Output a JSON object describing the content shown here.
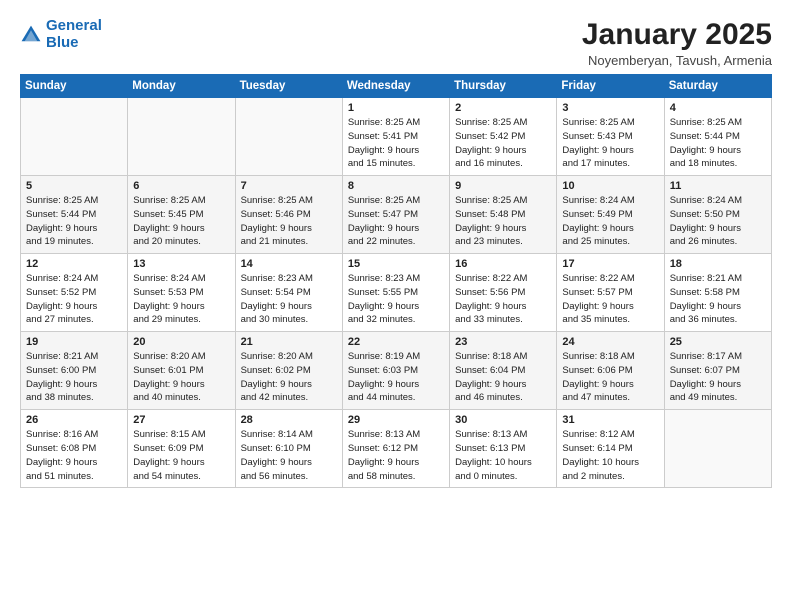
{
  "logo": {
    "line1": "General",
    "line2": "Blue"
  },
  "title": "January 2025",
  "location": "Noyemberyan, Tavush, Armenia",
  "weekdays": [
    "Sunday",
    "Monday",
    "Tuesday",
    "Wednesday",
    "Thursday",
    "Friday",
    "Saturday"
  ],
  "weeks": [
    [
      {
        "day": "",
        "text": ""
      },
      {
        "day": "",
        "text": ""
      },
      {
        "day": "",
        "text": ""
      },
      {
        "day": "1",
        "text": "Sunrise: 8:25 AM\nSunset: 5:41 PM\nDaylight: 9 hours\nand 15 minutes."
      },
      {
        "day": "2",
        "text": "Sunrise: 8:25 AM\nSunset: 5:42 PM\nDaylight: 9 hours\nand 16 minutes."
      },
      {
        "day": "3",
        "text": "Sunrise: 8:25 AM\nSunset: 5:43 PM\nDaylight: 9 hours\nand 17 minutes."
      },
      {
        "day": "4",
        "text": "Sunrise: 8:25 AM\nSunset: 5:44 PM\nDaylight: 9 hours\nand 18 minutes."
      }
    ],
    [
      {
        "day": "5",
        "text": "Sunrise: 8:25 AM\nSunset: 5:44 PM\nDaylight: 9 hours\nand 19 minutes."
      },
      {
        "day": "6",
        "text": "Sunrise: 8:25 AM\nSunset: 5:45 PM\nDaylight: 9 hours\nand 20 minutes."
      },
      {
        "day": "7",
        "text": "Sunrise: 8:25 AM\nSunset: 5:46 PM\nDaylight: 9 hours\nand 21 minutes."
      },
      {
        "day": "8",
        "text": "Sunrise: 8:25 AM\nSunset: 5:47 PM\nDaylight: 9 hours\nand 22 minutes."
      },
      {
        "day": "9",
        "text": "Sunrise: 8:25 AM\nSunset: 5:48 PM\nDaylight: 9 hours\nand 23 minutes."
      },
      {
        "day": "10",
        "text": "Sunrise: 8:24 AM\nSunset: 5:49 PM\nDaylight: 9 hours\nand 25 minutes."
      },
      {
        "day": "11",
        "text": "Sunrise: 8:24 AM\nSunset: 5:50 PM\nDaylight: 9 hours\nand 26 minutes."
      }
    ],
    [
      {
        "day": "12",
        "text": "Sunrise: 8:24 AM\nSunset: 5:52 PM\nDaylight: 9 hours\nand 27 minutes."
      },
      {
        "day": "13",
        "text": "Sunrise: 8:24 AM\nSunset: 5:53 PM\nDaylight: 9 hours\nand 29 minutes."
      },
      {
        "day": "14",
        "text": "Sunrise: 8:23 AM\nSunset: 5:54 PM\nDaylight: 9 hours\nand 30 minutes."
      },
      {
        "day": "15",
        "text": "Sunrise: 8:23 AM\nSunset: 5:55 PM\nDaylight: 9 hours\nand 32 minutes."
      },
      {
        "day": "16",
        "text": "Sunrise: 8:22 AM\nSunset: 5:56 PM\nDaylight: 9 hours\nand 33 minutes."
      },
      {
        "day": "17",
        "text": "Sunrise: 8:22 AM\nSunset: 5:57 PM\nDaylight: 9 hours\nand 35 minutes."
      },
      {
        "day": "18",
        "text": "Sunrise: 8:21 AM\nSunset: 5:58 PM\nDaylight: 9 hours\nand 36 minutes."
      }
    ],
    [
      {
        "day": "19",
        "text": "Sunrise: 8:21 AM\nSunset: 6:00 PM\nDaylight: 9 hours\nand 38 minutes."
      },
      {
        "day": "20",
        "text": "Sunrise: 8:20 AM\nSunset: 6:01 PM\nDaylight: 9 hours\nand 40 minutes."
      },
      {
        "day": "21",
        "text": "Sunrise: 8:20 AM\nSunset: 6:02 PM\nDaylight: 9 hours\nand 42 minutes."
      },
      {
        "day": "22",
        "text": "Sunrise: 8:19 AM\nSunset: 6:03 PM\nDaylight: 9 hours\nand 44 minutes."
      },
      {
        "day": "23",
        "text": "Sunrise: 8:18 AM\nSunset: 6:04 PM\nDaylight: 9 hours\nand 46 minutes."
      },
      {
        "day": "24",
        "text": "Sunrise: 8:18 AM\nSunset: 6:06 PM\nDaylight: 9 hours\nand 47 minutes."
      },
      {
        "day": "25",
        "text": "Sunrise: 8:17 AM\nSunset: 6:07 PM\nDaylight: 9 hours\nand 49 minutes."
      }
    ],
    [
      {
        "day": "26",
        "text": "Sunrise: 8:16 AM\nSunset: 6:08 PM\nDaylight: 9 hours\nand 51 minutes."
      },
      {
        "day": "27",
        "text": "Sunrise: 8:15 AM\nSunset: 6:09 PM\nDaylight: 9 hours\nand 54 minutes."
      },
      {
        "day": "28",
        "text": "Sunrise: 8:14 AM\nSunset: 6:10 PM\nDaylight: 9 hours\nand 56 minutes."
      },
      {
        "day": "29",
        "text": "Sunrise: 8:13 AM\nSunset: 6:12 PM\nDaylight: 9 hours\nand 58 minutes."
      },
      {
        "day": "30",
        "text": "Sunrise: 8:13 AM\nSunset: 6:13 PM\nDaylight: 10 hours\nand 0 minutes."
      },
      {
        "day": "31",
        "text": "Sunrise: 8:12 AM\nSunset: 6:14 PM\nDaylight: 10 hours\nand 2 minutes."
      },
      {
        "day": "",
        "text": ""
      }
    ]
  ]
}
